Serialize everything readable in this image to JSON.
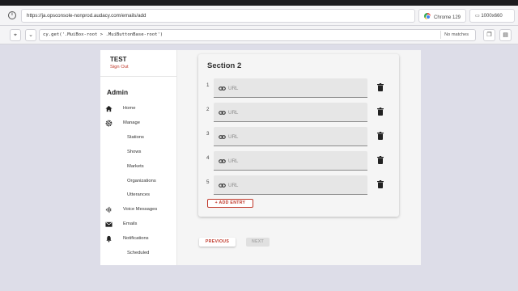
{
  "browser": {
    "url": "https://ja.opsconsole-nonprod.audacy.com/emails/add",
    "browser_label": "Chrome 129",
    "viewport_label": "1000x660"
  },
  "cypress": {
    "selector": "cy.get('.MuiBox-root > .MuiButtonBase-root')",
    "match_status": "No matches"
  },
  "sidebar": {
    "brand": "TEST",
    "sign_out": "Sign Out",
    "section_title": "Admin",
    "items": [
      {
        "label": "Home",
        "icon": "home-icon"
      },
      {
        "label": "Manage",
        "icon": "gear-icon"
      },
      {
        "label": "Stations",
        "icon": ""
      },
      {
        "label": "Shows",
        "icon": ""
      },
      {
        "label": "Markets",
        "icon": ""
      },
      {
        "label": "Organizations",
        "icon": ""
      },
      {
        "label": "Utterances",
        "icon": ""
      },
      {
        "label": "Voice Messages",
        "icon": "waveform-icon"
      },
      {
        "label": "Emails",
        "icon": "mail-icon"
      },
      {
        "label": "Notifications",
        "icon": "bell-icon"
      },
      {
        "label": "Scheduled",
        "icon": ""
      }
    ]
  },
  "section": {
    "title": "Section 2",
    "entries": [
      {
        "num": "1",
        "placeholder": "URL"
      },
      {
        "num": "2",
        "placeholder": "URL"
      },
      {
        "num": "3",
        "placeholder": "URL"
      },
      {
        "num": "4",
        "placeholder": "URL"
      },
      {
        "num": "5",
        "placeholder": "URL"
      }
    ],
    "add_entry_label": "+ ADD ENTRY"
  },
  "footer": {
    "previous_label": "PREVIOUS",
    "next_label": "NEXT"
  },
  "colors": {
    "accent": "#c0392b",
    "background": "#dddde8"
  }
}
